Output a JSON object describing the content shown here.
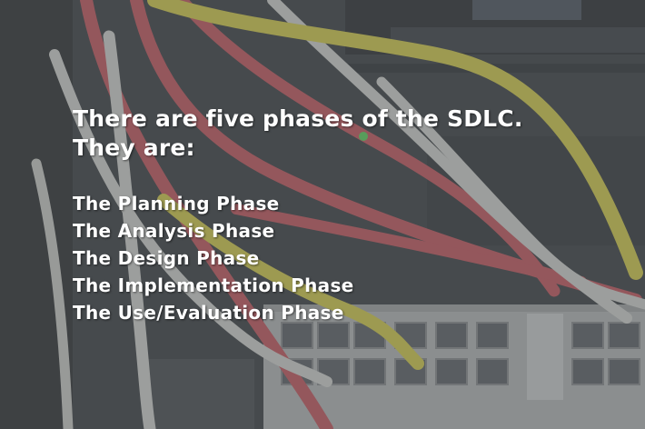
{
  "slide": {
    "heading_line1": "There are five phases of the SDLC.",
    "heading_line2": "They are:",
    "phases": [
      "The Planning Phase",
      "The Analysis Phase",
      "The Design Phase",
      "The Implementation Phase",
      "The Use/Evaluation Phase"
    ]
  },
  "background": {
    "subject": "network-cables-photo",
    "colors": {
      "rack": "#3a3d40",
      "overlay": "#55585c",
      "cable_red": "#c9565d",
      "cable_white": "#d8d8d3",
      "cable_yellow": "#d9cf49",
      "switch_panel": "#b9bbbb"
    }
  }
}
